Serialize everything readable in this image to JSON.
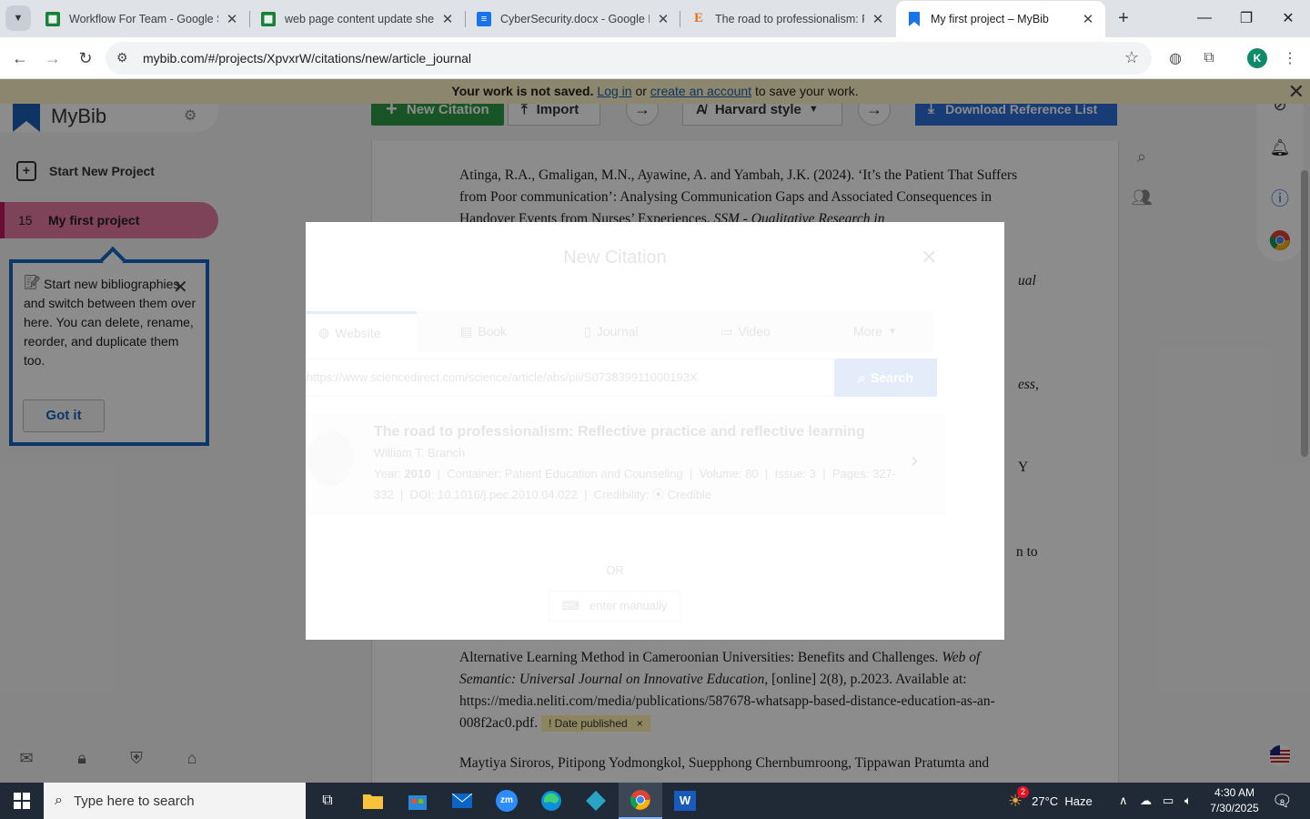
{
  "browser": {
    "tabs": [
      {
        "title": "Workflow For Team - Google Sheets",
        "icon": "sheets-icon",
        "color": "#188038"
      },
      {
        "title": "web page content update sheet - Google Sheets",
        "icon": "sheets-icon",
        "color": "#188038"
      },
      {
        "title": "CyberSecurity.docx - Google Docs",
        "icon": "docs-icon",
        "color": "#1a73e8"
      },
      {
        "title": "The road to professionalism: Reflective practice",
        "icon": "elsevier-icon",
        "color": "#e9711c"
      },
      {
        "title": "My first project – MyBib",
        "icon": "mybib-icon",
        "color": "#1a73e8"
      }
    ],
    "url": "mybib.com/#/projects/XpvxrW/citations/new/article_journal",
    "profile_initial": "K"
  },
  "banner": {
    "bold": "Your work is not saved.",
    "login": "Log in",
    "or": "or",
    "create": "create an account",
    "tail": "to save your work."
  },
  "sidebar": {
    "logo": "MyBib",
    "new_project": "Start New Project",
    "project_count": "15",
    "project_name": "My first project"
  },
  "tooltip": {
    "text": "Start new bibliographies and switch between them over here. You can delete, rename, reorder, and duplicate them too.",
    "button": "Got it"
  },
  "toolbar": {
    "new_citation": "New Citation",
    "import": "Import",
    "style": "Harvard style",
    "download": "Download Reference List"
  },
  "references": {
    "r1_a": "Atinga, R.A., Gmaligan, M.N., Ayawine, A. and Yambah, J.K. (2024). ‘It’s the Patient That Suffers from Poor communication’: Analysing Communication Gaps and Associated Consequences in Handover Events from Nurses’ Experiences.",
    "r1_b": "SSM - Qualitative Research in",
    "frag_ual": "ual",
    "frag_ess": "ess,",
    "frag_y": "Y",
    "frag_nto": "n to",
    "r2_a": "Alternative Learning Method in Cameroonian Universities: Benefits and Challenges.",
    "r2_b": "Web of Semantic: Universal Journal on Innovative Education",
    "r2_c": ", [online] 2(8), p.2023. Available at: https://media.neliti.com/media/publications/587678-whatsapp-based-distance-education-as-an-008f2ac0.pdf.",
    "r2_tag": "! Date published",
    "r2_tag_x": "×",
    "r3": "Maytiya Siroros, Pitipong Yodmongkol, Suepphong Chernbumroong, Tippawan Pratumta and"
  },
  "modal": {
    "title": "New Citation",
    "tabs": [
      "Website",
      "Book",
      "Journal",
      "Video",
      "More"
    ],
    "input_value": "https://www.sciencedirect.com/science/article/abs/pii/S073839911000193X",
    "search": "Search",
    "result": {
      "title": "The road to professionalism: Reflective practice and reflective learning",
      "author": "William T. Branch",
      "year_label": "Year:",
      "year": "2010",
      "container_label": "Container:",
      "container": "Patient Education and Counseling",
      "volume_label": "Volume:",
      "volume": "80",
      "issue_label": "Issue:",
      "issue": "3",
      "pages_label": "Pages:",
      "pages": "327-332",
      "doi_label": "DOI:",
      "doi": "10.1016/j.pec.2010.04.022",
      "cred_label": "Credibility:",
      "cred": "Credible"
    },
    "or": "OR",
    "manual": "enter manually"
  },
  "taskbar": {
    "search_placeholder": "Type here to search",
    "weather": "27°C  Haze",
    "weather_badge": "2",
    "time": "4:30 AM",
    "date": "7/30/2025",
    "notif_count": "8"
  },
  "colors": {
    "mybib_pink": "#e57ba1",
    "mybib_green": "#2e9a48",
    "mybib_blue": "#2a6dd8",
    "tooltip_border": "#1565c0"
  }
}
